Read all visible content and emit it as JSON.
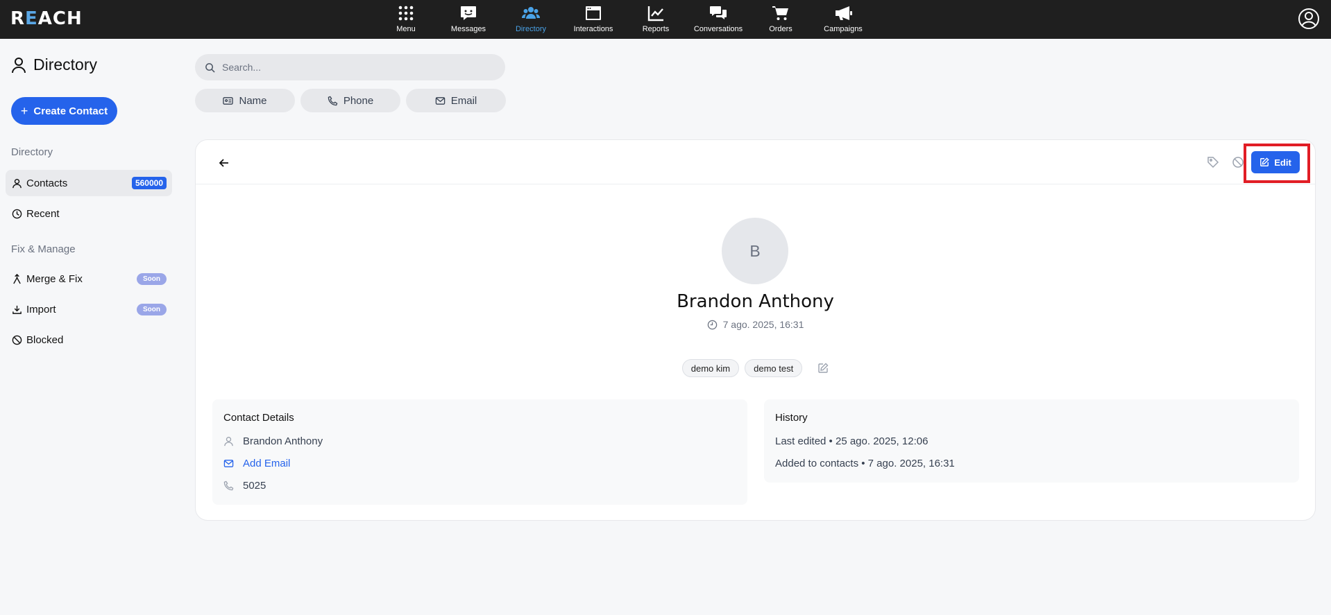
{
  "nav": {
    "logo": "REACH",
    "items": [
      {
        "label": "Menu",
        "icon": "grid-icon"
      },
      {
        "label": "Messages",
        "icon": "message-icon"
      },
      {
        "label": "Directory",
        "icon": "users-icon"
      },
      {
        "label": "Interactions",
        "icon": "window-icon"
      },
      {
        "label": "Reports",
        "icon": "chart-icon"
      },
      {
        "label": "Conversations",
        "icon": "chat-icon"
      },
      {
        "label": "Orders",
        "icon": "cart-icon"
      },
      {
        "label": "Campaigns",
        "icon": "megaphone-icon"
      }
    ],
    "active_color": "#4aa3e8"
  },
  "sidebar": {
    "title": "Directory",
    "create_label": "Create Contact",
    "section_directory": "Directory",
    "contacts_label": "Contacts",
    "contacts_count": "560000",
    "recent_label": "Recent",
    "section_fix": "Fix & Manage",
    "merge_label": "Merge & Fix",
    "merge_badge": "Soon",
    "import_label": "Import",
    "import_badge": "Soon",
    "blocked_label": "Blocked"
  },
  "search": {
    "placeholder": "Search..."
  },
  "filters": {
    "name": "Name",
    "phone": "Phone",
    "email": "Email"
  },
  "contact": {
    "edit_label": "Edit",
    "initial": "B",
    "name": "Brandon Anthony",
    "created": "7 ago. 2025, 16:31",
    "tags": [
      "demo kim",
      "demo test"
    ]
  },
  "details": {
    "title": "Contact Details",
    "full_name": "Brandon Anthony",
    "add_email": "Add Email",
    "phone": "5025"
  },
  "history": {
    "title": "History",
    "last_edited": "Last edited • 25 ago. 2025, 12:06",
    "added": "Added to contacts • 7 ago. 2025, 16:31"
  },
  "colors": {
    "primary": "#2563eb",
    "highlight": "#e11d25",
    "nav_bg": "#1f1f1f"
  }
}
